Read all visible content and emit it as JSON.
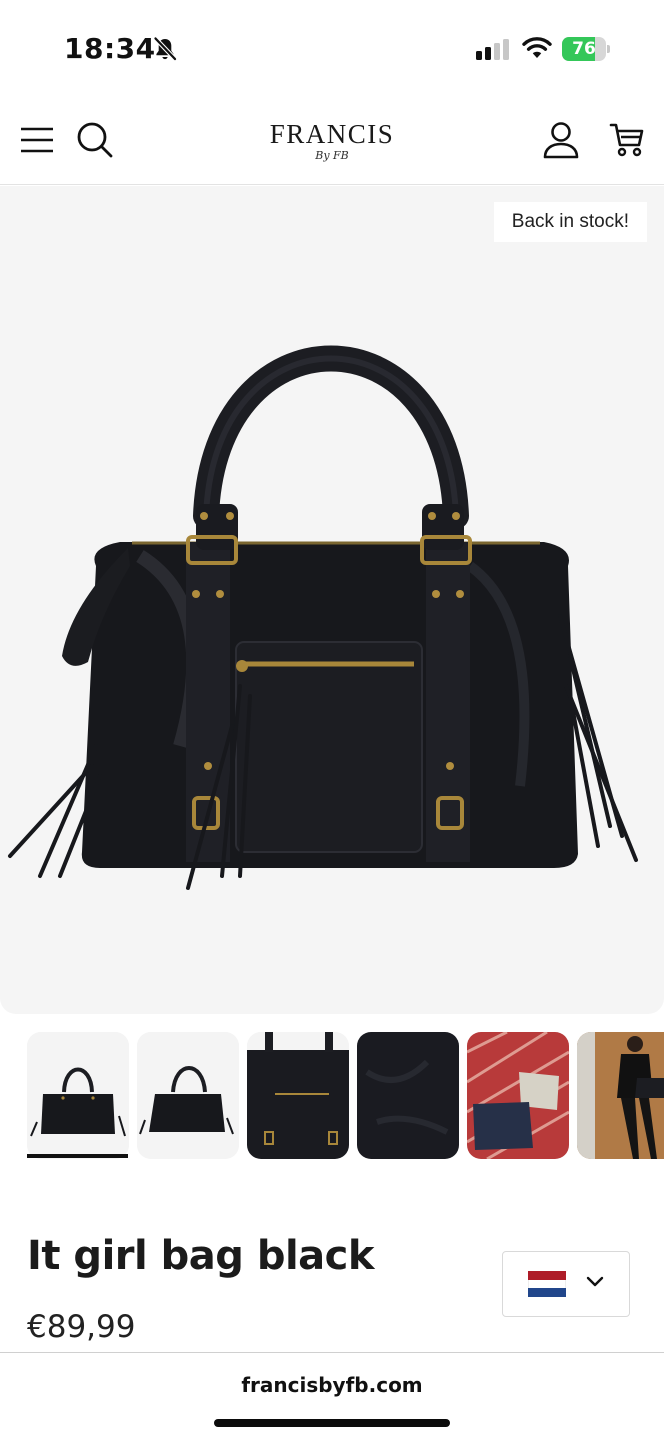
{
  "status_bar": {
    "time": "18:34",
    "battery_level": "76",
    "battery_fraction": 0.76
  },
  "header": {
    "logo_main": "FRANCIS",
    "logo_sub": "By FB",
    "icons": [
      "menu-icon",
      "search-icon",
      "account-icon",
      "cart-icon"
    ]
  },
  "product": {
    "badge": "Back in stock!",
    "title": "It girl bag black",
    "price": "€89,99",
    "thumbnails": [
      "bag-front",
      "bag-angle",
      "bag-detail",
      "leather-closeup",
      "lifestyle-bags-chair",
      "lifestyle-model"
    ],
    "active_thumbnail": 0
  },
  "country_selector": {
    "flag": "netherlands-flag",
    "flag_colors": [
      "#ae1c28",
      "#ffffff",
      "#21468b"
    ]
  },
  "browser": {
    "url": "francisbyfb.com"
  },
  "colors": {
    "accent": "#34c759",
    "image_bg": "#f5f5f5",
    "text": "#1b1b1b"
  }
}
